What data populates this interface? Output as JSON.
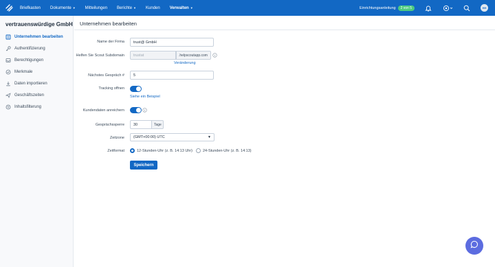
{
  "nav": {
    "items": [
      {
        "label": "Briefkasten",
        "caret": false
      },
      {
        "label": "Dokumente",
        "caret": true
      },
      {
        "label": "Mitteilungen",
        "caret": false
      },
      {
        "label": "Berichte",
        "caret": true
      },
      {
        "label": "Kunden",
        "caret": false
      },
      {
        "label": "Verwalten",
        "caret": true,
        "active": true
      }
    ],
    "setup_label": "Einrichtungsanleitung",
    "setup_badge": "2 von 5",
    "avatar_initials": "HH"
  },
  "sidebar": {
    "company": "vertrauenswürdige GmbH",
    "items": [
      {
        "label": "Unternehmen bearbeiten",
        "icon": "building-icon",
        "active": true
      },
      {
        "label": "Authentifizierung",
        "icon": "key-icon"
      },
      {
        "label": "Berechtigungen",
        "icon": "inbox-icon"
      },
      {
        "label": "Merkmale",
        "icon": "check-circle-icon"
      },
      {
        "label": "Daten importieren",
        "icon": "download-icon"
      },
      {
        "label": "Geschäftszeiten",
        "icon": "send-icon"
      },
      {
        "label": "Inhaltsfilterung",
        "icon": "filter-circle-icon"
      }
    ]
  },
  "page": {
    "title": "Unternehmen bearbeiten"
  },
  "form": {
    "company_name_label": "Name der Firma",
    "company_name_value": "trust@ GmbH",
    "subdomain_label": "Helfen Sie Scout Subdomain",
    "subdomain_value": "trustat",
    "subdomain_suffix": ".helpscoutapp.com",
    "subdomain_change_link": "Veränderung",
    "next_conversation_label": "Nächstes Gespräch #",
    "next_conversation_value": "5",
    "tracking_label": "Tracking offnen",
    "tracking_link": "Siehe ein Beispiel",
    "enrich_label": "Kundendaten anreichern",
    "lock_label": "Gesprächssperre",
    "lock_value": "30",
    "lock_unit": "Tage",
    "timezone_label": "Zeitzone",
    "timezone_value": "(GMT+00:00) UTC",
    "time_format_label": "Zeitformat",
    "time_format_12": "12-Stunden-Uhr (z. B. 14:13 Uhr)",
    "time_format_24": "24-Stunden-Uhr (z. B. 14:13)",
    "save_label": "Speichern"
  },
  "colors": {
    "brand": "#1268c4",
    "setup_badge": "#4ccb80",
    "beacon": "#5c6ce0"
  }
}
